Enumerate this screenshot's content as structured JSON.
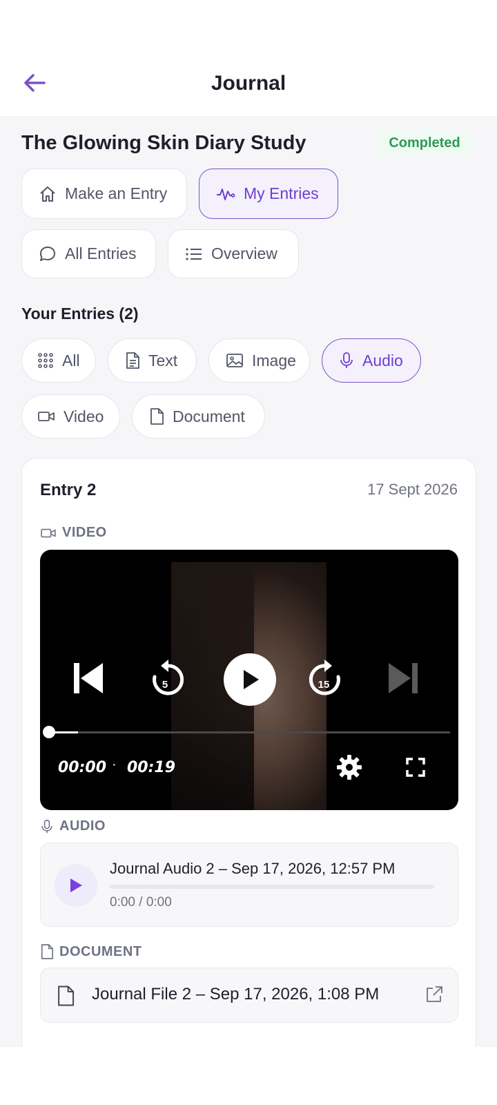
{
  "header": {
    "title": "Journal"
  },
  "study": {
    "title": "The Glowing Skin Diary Study",
    "status": "Completed"
  },
  "tabs": [
    {
      "label": "Make an Entry",
      "icon": "home-icon"
    },
    {
      "label": "My Entries",
      "icon": "activity-icon",
      "active": true
    },
    {
      "label": "All Entries",
      "icon": "chat-bubble-icon"
    },
    {
      "label": "Overview",
      "icon": "list-icon"
    }
  ],
  "entries_section": {
    "title": "Your Entries (2)"
  },
  "filters": [
    {
      "label": "All",
      "icon": "grid-icon"
    },
    {
      "label": "Text",
      "icon": "file-text-icon"
    },
    {
      "label": "Image",
      "icon": "image-icon"
    },
    {
      "label": "Audio",
      "icon": "mic-icon",
      "active": true
    },
    {
      "label": "Video",
      "icon": "video-icon"
    },
    {
      "label": "Document",
      "icon": "file-icon"
    }
  ],
  "entry": {
    "title": "Entry 2",
    "date": "17 Sept 2026",
    "video": {
      "label": "VIDEO",
      "current_time": "00:00",
      "separator": "·",
      "duration": "00:19",
      "rewind_seconds": "5",
      "forward_seconds": "15",
      "progress": 0.07
    },
    "audio": {
      "label": "AUDIO",
      "title": "Journal Audio 2 – Sep 17, 2026, 12:57 PM",
      "time": "0:00 / 0:00"
    },
    "document": {
      "label": "DOCUMENT",
      "title": "Journal File 2 – Sep 17, 2026, 1:08 PM"
    }
  },
  "colors": {
    "accent": "#7a52c6",
    "status_green": "#2e9a55",
    "background": "#f6f6f9"
  }
}
